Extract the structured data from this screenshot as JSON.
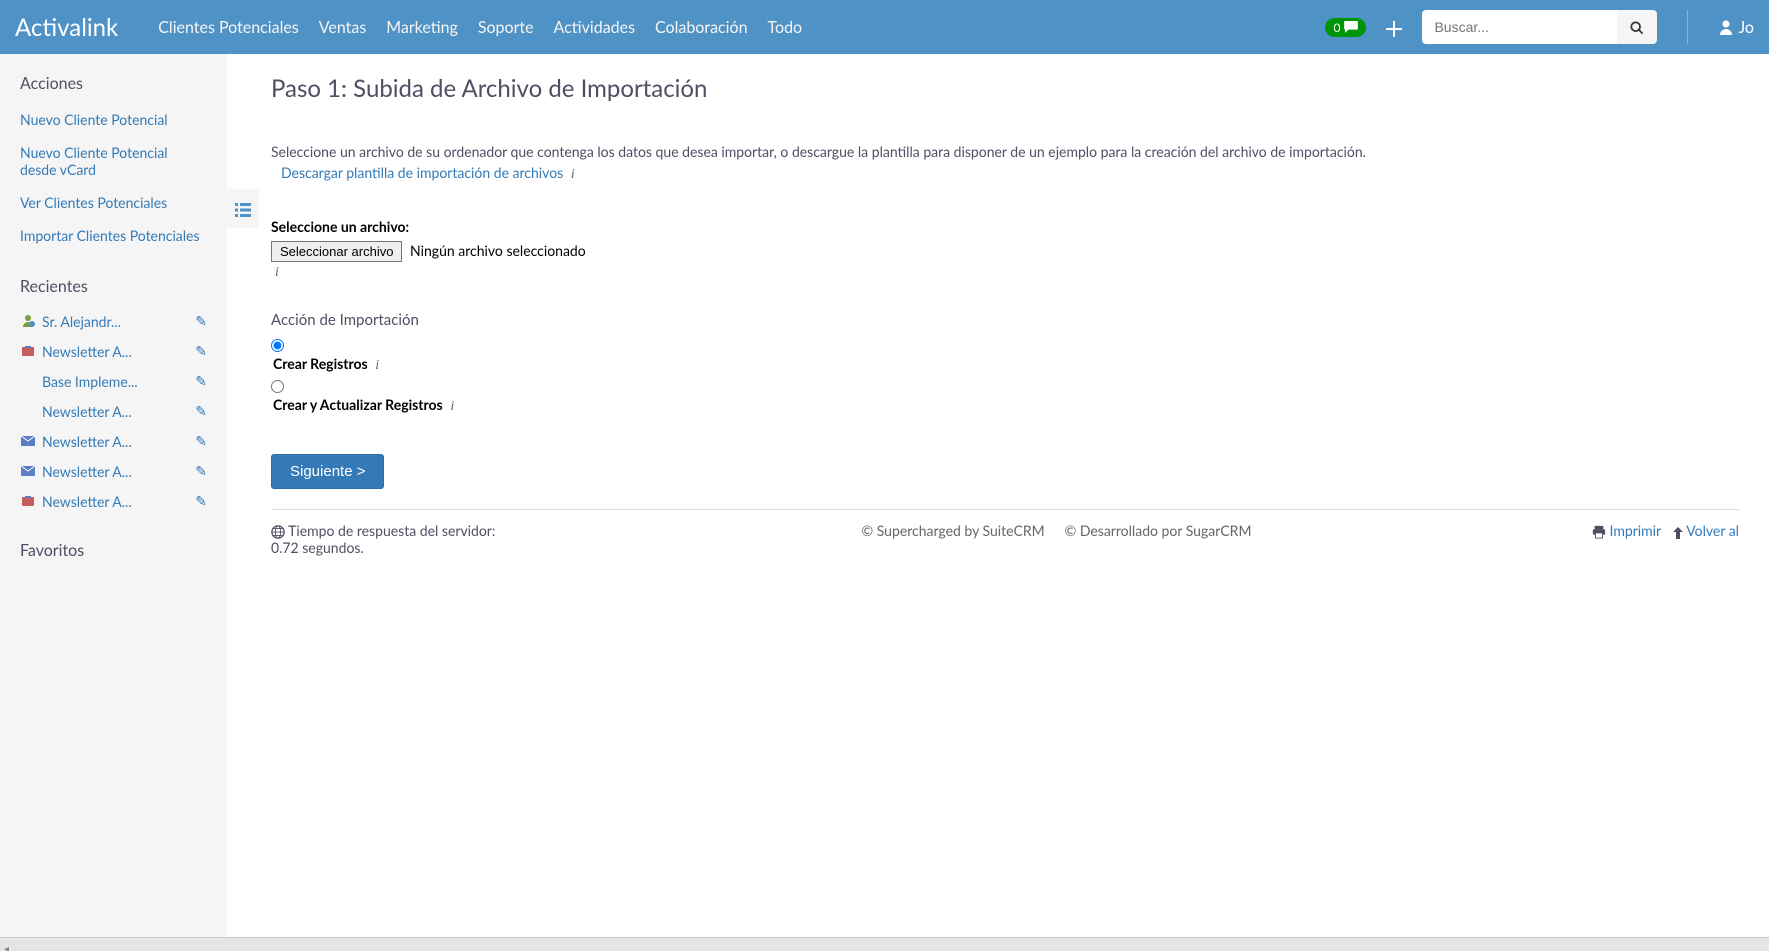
{
  "brand": "Activalink",
  "nav": [
    "Clientes Potenciales",
    "Ventas",
    "Marketing",
    "Soporte",
    "Actividades",
    "Colaboración",
    "Todo"
  ],
  "badge_count": "0",
  "search_placeholder": "Buscar...",
  "user_short": "Jo",
  "sidebar": {
    "actions_title": "Acciones",
    "actions": [
      "Nuevo Cliente Potencial",
      "Nuevo Cliente Potencial desde vCard",
      "Ver Clientes Potenciales",
      "Importar Clientes Potenciales"
    ],
    "recents_title": "Recientes",
    "recents": [
      {
        "label": "Sr. Alejandr...",
        "icon": "lead"
      },
      {
        "label": "Newsletter A...",
        "icon": "campaign"
      },
      {
        "label": "Base Impleme...",
        "icon": "none"
      },
      {
        "label": "Newsletter A...",
        "icon": "none"
      },
      {
        "label": "Newsletter A...",
        "icon": "email"
      },
      {
        "label": "Newsletter A...",
        "icon": "email"
      },
      {
        "label": "Newsletter A...",
        "icon": "campaign"
      }
    ],
    "favs_title": "Favoritos"
  },
  "main": {
    "title": "Paso 1: Subida de Archivo de Importación",
    "instruction": "Seleccione un archivo de su ordenador que contenga los datos que desea importar, o descargue la plantilla para disponer de un ejemplo para la creación del archivo de importación.",
    "download_link": "Descargar plantilla de importación de archivos",
    "select_file_label": "Seleccione un archivo:",
    "file_button": "Seleccionar archivo",
    "file_status": "Ningún archivo seleccionado",
    "import_action_label": "Acción de Importación",
    "radio1": "Crear Registros",
    "radio2": "Crear y Actualizar Registros",
    "next": "Siguiente >"
  },
  "footer": {
    "response": "Tiempo de respuesta del servidor: 0.72 segundos.",
    "suite": "© Supercharged by SuiteCRM",
    "sugar": "© Desarrollado por SugarCRM",
    "print": "Imprimir",
    "top": "Volver al"
  }
}
